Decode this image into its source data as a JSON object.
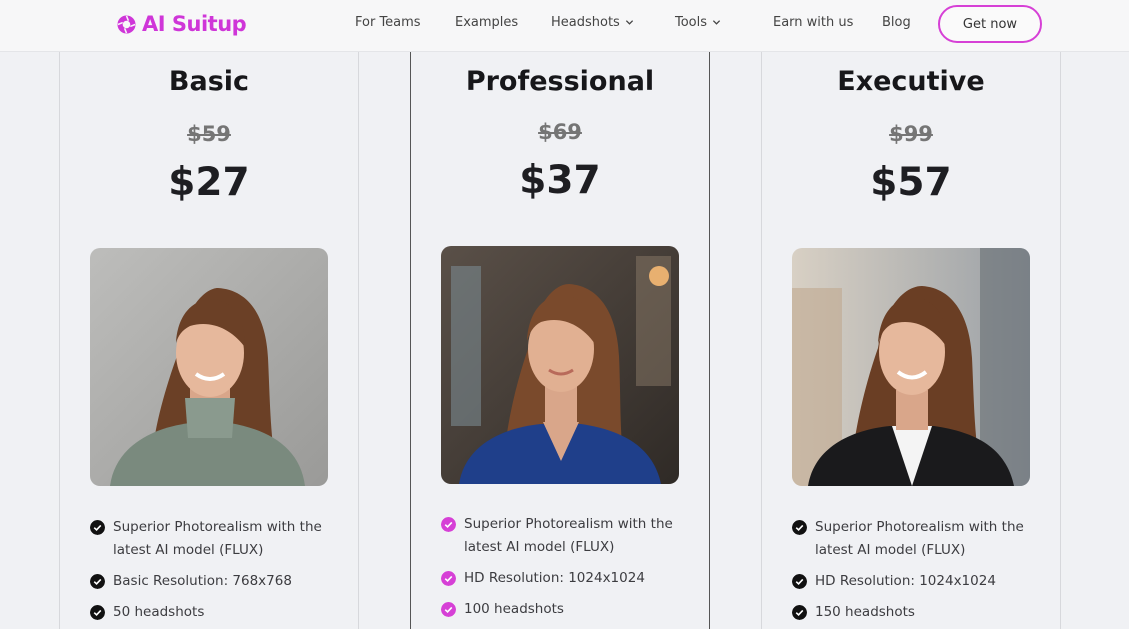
{
  "brand": {
    "name": "AI Suitup",
    "accent": "#cf36d8"
  },
  "nav": {
    "items": [
      {
        "label": "For Teams"
      },
      {
        "label": "Examples"
      },
      {
        "label": "Headshots",
        "dropdown": true
      },
      {
        "label": "Tools",
        "dropdown": true
      },
      {
        "label": "Earn with us"
      },
      {
        "label": "Blog"
      }
    ],
    "cta_label": "Get now"
  },
  "plans": [
    {
      "name": "Basic",
      "old_price": "$59",
      "price": "$27",
      "check_color": "#111111",
      "photo_icon": "woman-headshot-gray-sweater",
      "features": [
        "Superior Photorealism with the latest AI model (FLUX)",
        "Basic Resolution: 768x768",
        "50 headshots"
      ]
    },
    {
      "name": "Professional",
      "old_price": "$69",
      "price": "$37",
      "check_color": "#d640d6",
      "photo_icon": "woman-headshot-blue-blouse",
      "features": [
        "Superior Photorealism with the latest AI model (FLUX)",
        "HD Resolution: 1024x1024",
        "100 headshots"
      ]
    },
    {
      "name": "Executive",
      "old_price": "$99",
      "price": "$57",
      "check_color": "#111111",
      "photo_icon": "woman-headshot-black-blazer",
      "features": [
        "Superior Photorealism with the latest AI model (FLUX)",
        "HD Resolution: 1024x1024",
        "150 headshots"
      ]
    }
  ]
}
